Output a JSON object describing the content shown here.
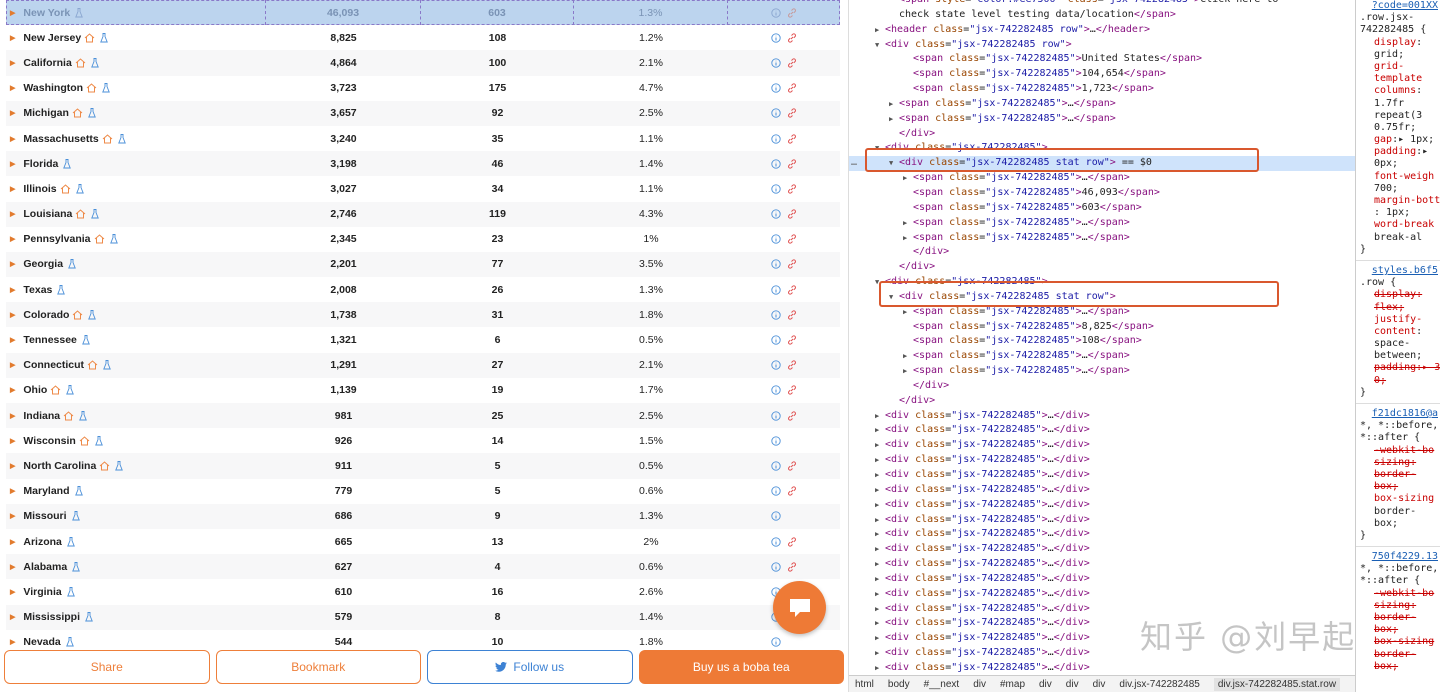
{
  "table": {
    "first_row": {
      "name": "New York",
      "cases": "46,093",
      "deaths": "603",
      "pct": "1.3%"
    },
    "rows": [
      {
        "name": "New Jersey",
        "home": true,
        "cases": "8,825",
        "deaths": "108",
        "pct": "1.2%",
        "link": true
      },
      {
        "name": "California",
        "home": true,
        "cases": "4,864",
        "deaths": "100",
        "pct": "2.1%",
        "link": true
      },
      {
        "name": "Washington",
        "home": true,
        "cases": "3,723",
        "deaths": "175",
        "pct": "4.7%",
        "link": true
      },
      {
        "name": "Michigan",
        "home": true,
        "cases": "3,657",
        "deaths": "92",
        "pct": "2.5%",
        "link": true
      },
      {
        "name": "Massachusetts",
        "home": true,
        "cases": "3,240",
        "deaths": "35",
        "pct": "1.1%",
        "link": true
      },
      {
        "name": "Florida",
        "home": false,
        "cases": "3,198",
        "deaths": "46",
        "pct": "1.4%",
        "link": true
      },
      {
        "name": "Illinois",
        "home": true,
        "cases": "3,027",
        "deaths": "34",
        "pct": "1.1%",
        "link": true
      },
      {
        "name": "Louisiana",
        "home": true,
        "cases": "2,746",
        "deaths": "119",
        "pct": "4.3%",
        "link": true
      },
      {
        "name": "Pennsylvania",
        "home": true,
        "cases": "2,345",
        "deaths": "23",
        "pct": "1%",
        "link": true
      },
      {
        "name": "Georgia",
        "home": false,
        "cases": "2,201",
        "deaths": "77",
        "pct": "3.5%",
        "link": true
      },
      {
        "name": "Texas",
        "home": false,
        "cases": "2,008",
        "deaths": "26",
        "pct": "1.3%",
        "link": true
      },
      {
        "name": "Colorado",
        "home": true,
        "cases": "1,738",
        "deaths": "31",
        "pct": "1.8%",
        "link": true
      },
      {
        "name": "Tennessee",
        "home": false,
        "cases": "1,321",
        "deaths": "6",
        "pct": "0.5%",
        "link": true
      },
      {
        "name": "Connecticut",
        "home": true,
        "cases": "1,291",
        "deaths": "27",
        "pct": "2.1%",
        "link": true
      },
      {
        "name": "Ohio",
        "home": true,
        "cases": "1,139",
        "deaths": "19",
        "pct": "1.7%",
        "link": true
      },
      {
        "name": "Indiana",
        "home": true,
        "cases": "981",
        "deaths": "25",
        "pct": "2.5%",
        "link": true
      },
      {
        "name": "Wisconsin",
        "home": true,
        "cases": "926",
        "deaths": "14",
        "pct": "1.5%",
        "link": false
      },
      {
        "name": "North Carolina",
        "home": true,
        "cases": "911",
        "deaths": "5",
        "pct": "0.5%",
        "link": true
      },
      {
        "name": "Maryland",
        "home": false,
        "cases": "779",
        "deaths": "5",
        "pct": "0.6%",
        "link": true
      },
      {
        "name": "Missouri",
        "home": false,
        "cases": "686",
        "deaths": "9",
        "pct": "1.3%",
        "link": false
      },
      {
        "name": "Arizona",
        "home": false,
        "cases": "665",
        "deaths": "13",
        "pct": "2%",
        "link": true
      },
      {
        "name": "Alabama",
        "home": false,
        "cases": "627",
        "deaths": "4",
        "pct": "0.6%",
        "link": true
      },
      {
        "name": "Virginia",
        "home": false,
        "cases": "610",
        "deaths": "16",
        "pct": "2.6%",
        "link": false
      },
      {
        "name": "Mississippi",
        "home": false,
        "cases": "579",
        "deaths": "8",
        "pct": "1.4%",
        "link": false
      },
      {
        "name": "Nevada",
        "home": false,
        "cases": "544",
        "deaths": "10",
        "pct": "1.8%",
        "link": false
      }
    ]
  },
  "buttons": {
    "share": "Share",
    "bookmark": "Bookmark",
    "follow": "Follow us",
    "boba": "Buy us a boba tea"
  },
  "elements_pane": {
    "lines": [
      {
        "indent": 5,
        "tri": "",
        "html": "<span class='tag'>&lt;span</span> <span class='attr'>style</span>=<span class='val'>\"color:#ee7500\"</span> <span class='attr'>class</span>=<span class='val'>\"jsx-742282485\"</span><span class='tag'>&gt;</span><span class='tx'>Click here to</span>"
      },
      {
        "indent": 5,
        "tri": "",
        "html": "<span class='tx'>check state level testing data/location</span><span class='tag'>&lt;/span&gt;</span>"
      },
      {
        "indent": 4,
        "tri": "▶",
        "html": "<span class='tag'>&lt;header</span> <span class='attr'>class</span>=<span class='val'>\"jsx-742282485 row\"</span><span class='tag'>&gt;</span>…<span class='tag'>&lt;/header&gt;</span>"
      },
      {
        "indent": 4,
        "tri": "▼",
        "html": "<span class='tag'>&lt;div</span> <span class='attr'>class</span>=<span class='val'>\"jsx-742282485 row\"</span><span class='tag'>&gt;</span>"
      },
      {
        "indent": 6,
        "tri": "",
        "html": "<span class='tag'>&lt;span</span> <span class='attr'>class</span>=<span class='val'>\"jsx-742282485\"</span><span class='tag'>&gt;</span>United States<span class='tag'>&lt;/span&gt;</span>"
      },
      {
        "indent": 6,
        "tri": "",
        "html": "<span class='tag'>&lt;span</span> <span class='attr'>class</span>=<span class='val'>\"jsx-742282485\"</span><span class='tag'>&gt;</span>104,654<span class='tag'>&lt;/span&gt;</span>"
      },
      {
        "indent": 6,
        "tri": "",
        "html": "<span class='tag'>&lt;span</span> <span class='attr'>class</span>=<span class='val'>\"jsx-742282485\"</span><span class='tag'>&gt;</span>1,723<span class='tag'>&lt;/span&gt;</span>"
      },
      {
        "indent": 5,
        "tri": "▶",
        "html": "<span class='tag'>&lt;span</span> <span class='attr'>class</span>=<span class='val'>\"jsx-742282485\"</span><span class='tag'>&gt;</span>…<span class='tag'>&lt;/span&gt;</span>"
      },
      {
        "indent": 5,
        "tri": "▶",
        "html": "<span class='tag'>&lt;span</span> <span class='attr'>class</span>=<span class='val'>\"jsx-742282485\"</span><span class='tag'>&gt;</span>…<span class='tag'>&lt;/span&gt;</span>"
      },
      {
        "indent": 5,
        "tri": "",
        "html": "<span class='tag'>&lt;/div&gt;</span>"
      },
      {
        "indent": 4,
        "tri": "▼",
        "html": "<span class='tag'>&lt;div</span> <span class='attr'>class</span>=<span class='val'>\"jsx-742282485\"</span><span class='tag'>&gt;</span>"
      },
      {
        "indent": 5,
        "tri": "▼",
        "sel": true,
        "html": "<span class='tag'>&lt;div</span> <span class='attr'>class</span>=<span class='val'>\"jsx-742282485 stat row\"</span><span class='tag'>&gt;</span> == $0"
      },
      {
        "indent": 6,
        "tri": "▶",
        "html": "<span class='tag'>&lt;span</span> <span class='attr'>class</span>=<span class='val'>\"jsx-742282485\"</span><span class='tag'>&gt;</span>…<span class='tag'>&lt;/span&gt;</span>"
      },
      {
        "indent": 6,
        "tri": "",
        "html": "<span class='tag'>&lt;span</span> <span class='attr'>class</span>=<span class='val'>\"jsx-742282485\"</span><span class='tag'>&gt;</span>46,093<span class='tag'>&lt;/span&gt;</span>"
      },
      {
        "indent": 6,
        "tri": "",
        "html": "<span class='tag'>&lt;span</span> <span class='attr'>class</span>=<span class='val'>\"jsx-742282485\"</span><span class='tag'>&gt;</span>603<span class='tag'>&lt;/span&gt;</span>"
      },
      {
        "indent": 6,
        "tri": "▶",
        "html": "<span class='tag'>&lt;span</span> <span class='attr'>class</span>=<span class='val'>\"jsx-742282485\"</span><span class='tag'>&gt;</span>…<span class='tag'>&lt;/span&gt;</span>"
      },
      {
        "indent": 6,
        "tri": "▶",
        "html": "<span class='tag'>&lt;span</span> <span class='attr'>class</span>=<span class='val'>\"jsx-742282485\"</span><span class='tag'>&gt;</span>…<span class='tag'>&lt;/span&gt;</span>"
      },
      {
        "indent": 6,
        "tri": "",
        "html": "<span class='tag'>&lt;/div&gt;</span>"
      },
      {
        "indent": 5,
        "tri": "",
        "html": "<span class='tag'>&lt;/div&gt;</span>"
      },
      {
        "indent": 4,
        "tri": "▼",
        "html": "<span class='tag'>&lt;div</span> <span class='attr'>class</span>=<span class='val'>\"jsx-742282485\"</span><span class='tag'>&gt;</span>"
      },
      {
        "indent": 5,
        "tri": "▼",
        "html": "<span class='tag'>&lt;div</span> <span class='attr'>class</span>=<span class='val'>\"jsx-742282485 stat row\"</span><span class='tag'>&gt;</span>"
      },
      {
        "indent": 6,
        "tri": "▶",
        "html": "<span class='tag'>&lt;span</span> <span class='attr'>class</span>=<span class='val'>\"jsx-742282485\"</span><span class='tag'>&gt;</span>…<span class='tag'>&lt;/span&gt;</span>"
      },
      {
        "indent": 6,
        "tri": "",
        "html": "<span class='tag'>&lt;span</span> <span class='attr'>class</span>=<span class='val'>\"jsx-742282485\"</span><span class='tag'>&gt;</span>8,825<span class='tag'>&lt;/span&gt;</span>"
      },
      {
        "indent": 6,
        "tri": "",
        "html": "<span class='tag'>&lt;span</span> <span class='attr'>class</span>=<span class='val'>\"jsx-742282485\"</span><span class='tag'>&gt;</span>108<span class='tag'>&lt;/span&gt;</span>"
      },
      {
        "indent": 6,
        "tri": "▶",
        "html": "<span class='tag'>&lt;span</span> <span class='attr'>class</span>=<span class='val'>\"jsx-742282485\"</span><span class='tag'>&gt;</span>…<span class='tag'>&lt;/span&gt;</span>"
      },
      {
        "indent": 6,
        "tri": "▶",
        "html": "<span class='tag'>&lt;span</span> <span class='attr'>class</span>=<span class='val'>\"jsx-742282485\"</span><span class='tag'>&gt;</span>…<span class='tag'>&lt;/span&gt;</span>"
      },
      {
        "indent": 6,
        "tri": "",
        "html": "<span class='tag'>&lt;/div&gt;</span>"
      },
      {
        "indent": 5,
        "tri": "",
        "html": "<span class='tag'>&lt;/div&gt;</span>"
      },
      {
        "indent": 4,
        "tri": "▶",
        "html": "<span class='tag'>&lt;div</span> <span class='attr'>class</span>=<span class='val'>\"jsx-742282485\"</span><span class='tag'>&gt;</span>…<span class='tag'>&lt;/div&gt;</span>"
      },
      {
        "indent": 4,
        "tri": "▶",
        "html": "<span class='tag'>&lt;div</span> <span class='attr'>class</span>=<span class='val'>\"jsx-742282485\"</span><span class='tag'>&gt;</span>…<span class='tag'>&lt;/div&gt;</span>"
      },
      {
        "indent": 4,
        "tri": "▶",
        "html": "<span class='tag'>&lt;div</span> <span class='attr'>class</span>=<span class='val'>\"jsx-742282485\"</span><span class='tag'>&gt;</span>…<span class='tag'>&lt;/div&gt;</span>"
      },
      {
        "indent": 4,
        "tri": "▶",
        "html": "<span class='tag'>&lt;div</span> <span class='attr'>class</span>=<span class='val'>\"jsx-742282485\"</span><span class='tag'>&gt;</span>…<span class='tag'>&lt;/div&gt;</span>"
      },
      {
        "indent": 4,
        "tri": "▶",
        "html": "<span class='tag'>&lt;div</span> <span class='attr'>class</span>=<span class='val'>\"jsx-742282485\"</span><span class='tag'>&gt;</span>…<span class='tag'>&lt;/div&gt;</span>"
      },
      {
        "indent": 4,
        "tri": "▶",
        "html": "<span class='tag'>&lt;div</span> <span class='attr'>class</span>=<span class='val'>\"jsx-742282485\"</span><span class='tag'>&gt;</span>…<span class='tag'>&lt;/div&gt;</span>"
      },
      {
        "indent": 4,
        "tri": "▶",
        "html": "<span class='tag'>&lt;div</span> <span class='attr'>class</span>=<span class='val'>\"jsx-742282485\"</span><span class='tag'>&gt;</span>…<span class='tag'>&lt;/div&gt;</span>"
      },
      {
        "indent": 4,
        "tri": "▶",
        "html": "<span class='tag'>&lt;div</span> <span class='attr'>class</span>=<span class='val'>\"jsx-742282485\"</span><span class='tag'>&gt;</span>…<span class='tag'>&lt;/div&gt;</span>"
      },
      {
        "indent": 4,
        "tri": "▶",
        "html": "<span class='tag'>&lt;div</span> <span class='attr'>class</span>=<span class='val'>\"jsx-742282485\"</span><span class='tag'>&gt;</span>…<span class='tag'>&lt;/div&gt;</span>"
      },
      {
        "indent": 4,
        "tri": "▶",
        "html": "<span class='tag'>&lt;div</span> <span class='attr'>class</span>=<span class='val'>\"jsx-742282485\"</span><span class='tag'>&gt;</span>…<span class='tag'>&lt;/div&gt;</span>"
      },
      {
        "indent": 4,
        "tri": "▶",
        "html": "<span class='tag'>&lt;div</span> <span class='attr'>class</span>=<span class='val'>\"jsx-742282485\"</span><span class='tag'>&gt;</span>…<span class='tag'>&lt;/div&gt;</span>"
      },
      {
        "indent": 4,
        "tri": "▶",
        "html": "<span class='tag'>&lt;div</span> <span class='attr'>class</span>=<span class='val'>\"jsx-742282485\"</span><span class='tag'>&gt;</span>…<span class='tag'>&lt;/div&gt;</span>"
      },
      {
        "indent": 4,
        "tri": "▶",
        "html": "<span class='tag'>&lt;div</span> <span class='attr'>class</span>=<span class='val'>\"jsx-742282485\"</span><span class='tag'>&gt;</span>…<span class='tag'>&lt;/div&gt;</span>"
      },
      {
        "indent": 4,
        "tri": "▶",
        "html": "<span class='tag'>&lt;div</span> <span class='attr'>class</span>=<span class='val'>\"jsx-742282485\"</span><span class='tag'>&gt;</span>…<span class='tag'>&lt;/div&gt;</span>"
      },
      {
        "indent": 4,
        "tri": "▶",
        "html": "<span class='tag'>&lt;div</span> <span class='attr'>class</span>=<span class='val'>\"jsx-742282485\"</span><span class='tag'>&gt;</span>…<span class='tag'>&lt;/div&gt;</span>"
      },
      {
        "indent": 4,
        "tri": "▶",
        "html": "<span class='tag'>&lt;div</span> <span class='attr'>class</span>=<span class='val'>\"jsx-742282485\"</span><span class='tag'>&gt;</span>…<span class='tag'>&lt;/div&gt;</span>"
      },
      {
        "indent": 4,
        "tri": "▶",
        "html": "<span class='tag'>&lt;div</span> <span class='attr'>class</span>=<span class='val'>\"jsx-742282485\"</span><span class='tag'>&gt;</span>…<span class='tag'>&lt;/div&gt;</span>"
      },
      {
        "indent": 4,
        "tri": "▶",
        "html": "<span class='tag'>&lt;div</span> <span class='attr'>class</span>=<span class='val'>\"jsx-742282485\"</span><span class='tag'>&gt;</span>…<span class='tag'>&lt;/div&gt;</span>"
      }
    ],
    "breadcrumbs": [
      "html",
      "body",
      "#__next",
      "div",
      "#map",
      "div",
      "div",
      "div",
      "div.jsx-742282485"
    ],
    "breadcrumb_active": "div.jsx-742282485.stat.row"
  },
  "styles_pane": {
    "lines": [
      {
        "cls": "link",
        "text": "?code=001XX"
      },
      {
        "cls": "",
        "text": ".row.jsx-"
      },
      {
        "cls": "",
        "text": "742282485 {"
      },
      {
        "cls": "ind",
        "html": "<span class='prop'>display</span>:"
      },
      {
        "cls": "ind",
        "text": "  grid;"
      },
      {
        "cls": "ind",
        "html": "<span class='prop'>grid-</span>"
      },
      {
        "cls": "ind",
        "html": "<span class='prop'>  template</span>"
      },
      {
        "cls": "ind",
        "html": "<span class='prop'>  columns</span>:"
      },
      {
        "cls": "ind",
        "text": "1.7fr"
      },
      {
        "cls": "ind",
        "text": "repeat(3"
      },
      {
        "cls": "ind",
        "text": "0.75fr;"
      },
      {
        "cls": "ind",
        "html": "<span class='prop'>gap</span>:▸ 1px;"
      },
      {
        "cls": "ind",
        "html": "<span class='prop'>padding</span>:▸"
      },
      {
        "cls": "ind",
        "text": "  0px;"
      },
      {
        "cls": "ind",
        "html": "<span class='prop'>font-weigh</span>"
      },
      {
        "cls": "ind",
        "text": "  700;"
      },
      {
        "cls": "ind",
        "html": "<span class='prop'>margin-bott</span>"
      },
      {
        "cls": "ind",
        "text": ": 1px;"
      },
      {
        "cls": "ind",
        "html": "<span class='prop'>word-break</span>"
      },
      {
        "cls": "ind",
        "text": "  break-al"
      },
      {
        "cls": "",
        "text": "}"
      },
      {
        "cls": "sep",
        "text": ""
      },
      {
        "cls": "link",
        "text": "styles.b6f5"
      },
      {
        "cls": "",
        "text": ".row {"
      },
      {
        "cls": "ind",
        "html": "<span class='strike'>display:</span>"
      },
      {
        "cls": "ind",
        "html": "<span class='strike'>  flex;</span>"
      },
      {
        "cls": "ind",
        "html": "<span class='prop'>justify-</span>"
      },
      {
        "cls": "ind",
        "html": "<span class='prop'>  content</span>:"
      },
      {
        "cls": "ind",
        "text": "  space-"
      },
      {
        "cls": "ind",
        "text": "  between;"
      },
      {
        "cls": "ind",
        "html": "<span class='strike'>padding:▸ 3</span>"
      },
      {
        "cls": "ind",
        "html": "<span class='strike'>  0;</span>"
      },
      {
        "cls": "",
        "text": "}"
      },
      {
        "cls": "sep",
        "text": ""
      },
      {
        "cls": "link",
        "text": "f21dc1816@a"
      },
      {
        "cls": "",
        "text": "*, *::before,"
      },
      {
        "cls": "",
        "text": "*::after {"
      },
      {
        "cls": "ind",
        "html": "<span class='strike'>-webkit-bo</span>"
      },
      {
        "cls": "ind",
        "html": "<span class='strike'>  sizing:</span>"
      },
      {
        "cls": "ind",
        "html": "<span class='strike'>  border-</span>"
      },
      {
        "cls": "ind",
        "html": "<span class='strike'>  box;</span>"
      },
      {
        "cls": "ind",
        "html": "<span class='prop'>box-sizing</span>"
      },
      {
        "cls": "ind",
        "text": "  border-"
      },
      {
        "cls": "ind",
        "text": "  box;"
      },
      {
        "cls": "",
        "text": "}"
      },
      {
        "cls": "sep",
        "text": ""
      },
      {
        "cls": "link",
        "text": "750f4229.13"
      },
      {
        "cls": "",
        "text": "*, *::before,"
      },
      {
        "cls": "",
        "text": "*::after {"
      },
      {
        "cls": "ind",
        "html": "<span class='strike'>-webkit-bo</span>"
      },
      {
        "cls": "ind",
        "html": "<span class='strike'>  sizing:</span>"
      },
      {
        "cls": "ind",
        "html": "<span class='strike'>  border-</span>"
      },
      {
        "cls": "ind",
        "html": "<span class='strike'>  box;</span>"
      },
      {
        "cls": "ind",
        "html": "<span class='strike'>box-sizing</span>"
      },
      {
        "cls": "ind",
        "html": "<span class='strike'>  border-</span>"
      },
      {
        "cls": "ind",
        "html": "<span class='strike'>  box;</span>"
      }
    ]
  },
  "watermark": "知乎 @刘早起",
  "colors": {
    "accent": "#ee7a36",
    "twitter": "#3d82d4",
    "icon_blue": "#4a8fd8",
    "selection": "#cfe3fb"
  }
}
